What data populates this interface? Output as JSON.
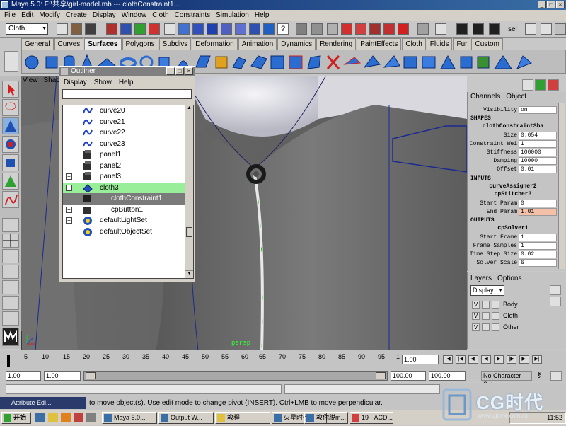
{
  "window": {
    "title": "Maya 5.0: F:\\共享\\girl-model.mb   ---   clothConstraint1..."
  },
  "menubar": [
    "File",
    "Edit",
    "Modify",
    "Create",
    "Display",
    "Window",
    "Cloth",
    "Constraints",
    "Simulation",
    "Help"
  ],
  "statusline": {
    "mode_menu": "Cloth",
    "sel_label": "sel"
  },
  "shelf": {
    "tabs": [
      "General",
      "Curves",
      "Surfaces",
      "Polygons",
      "Subdivs",
      "Deformation",
      "Animation",
      "Dynamics",
      "Rendering",
      "PaintEffects",
      "Cloth",
      "Fluids",
      "Fur",
      "Custom"
    ],
    "active_tab": "Surfaces"
  },
  "viewport": {
    "menu": [
      "View",
      "Shadi"
    ],
    "camera_label": "persp"
  },
  "outliner": {
    "title": "Outliner",
    "menu": [
      "Display",
      "Show",
      "Help"
    ],
    "items": [
      {
        "label": "curve20",
        "icon": "curve-icon",
        "expand": ""
      },
      {
        "label": "curve21",
        "icon": "curve-icon",
        "expand": ""
      },
      {
        "label": "curve22",
        "icon": "curve-icon",
        "expand": ""
      },
      {
        "label": "curve23",
        "icon": "curve-icon",
        "expand": ""
      },
      {
        "label": "panel1",
        "icon": "panel-icon",
        "expand": ""
      },
      {
        "label": "panel2",
        "icon": "panel-icon",
        "expand": ""
      },
      {
        "label": "panel3",
        "icon": "panel-icon",
        "expand": "+"
      },
      {
        "label": "cloth3",
        "icon": "cloth-icon",
        "expand": "−"
      },
      {
        "label": "clothConstraint1",
        "icon": "constraint-icon",
        "expand": ""
      },
      {
        "label": "cpButton1",
        "icon": "button-icon",
        "expand": "+"
      },
      {
        "label": "defaultLightSet",
        "icon": "set-icon",
        "expand": "+"
      },
      {
        "label": "defaultObjectSet",
        "icon": "set-icon",
        "expand": ""
      }
    ]
  },
  "channelbox": {
    "tabs": [
      "Channels",
      "Object"
    ],
    "visibility": {
      "label": "Visibility",
      "value": "on"
    },
    "shapes_header": "SHAPES",
    "shape_node": "clothConstraintSha",
    "shape_attrs": [
      {
        "label": "Size",
        "value": "0.054"
      },
      {
        "label": "Constraint Wei",
        "value": "1"
      },
      {
        "label": "Stiffness",
        "value": "100000"
      },
      {
        "label": "Damping",
        "value": "10000"
      },
      {
        "label": "Offset",
        "value": "0.01"
      }
    ],
    "inputs_header": "INPUTS",
    "input_node_1": "curveAssigner2",
    "input_node_2": "cpStitcher3",
    "input_attrs": [
      {
        "label": "Start Param",
        "value": "0"
      },
      {
        "label": "End Param",
        "value": "1.01"
      }
    ],
    "outputs_header": "OUTPUTS",
    "output_node": "cpSolver1",
    "output_attrs": [
      {
        "label": "Start Frame",
        "value": "1"
      },
      {
        "label": "Frame Samples",
        "value": "1"
      },
      {
        "label": "Time Step Size",
        "value": "0.02"
      },
      {
        "label": "Solver Scale",
        "value": "6"
      }
    ]
  },
  "layers": {
    "tabs": [
      "Layers",
      "Options"
    ],
    "display_menu": "Display",
    "items": [
      {
        "visible": "V",
        "name": "Body"
      },
      {
        "visible": "V",
        "name": "Cloth"
      },
      {
        "visible": "V",
        "name": "Other"
      }
    ]
  },
  "timeline": {
    "ticks": [
      "5",
      "10",
      "15",
      "20",
      "25",
      "30",
      "35",
      "40",
      "45",
      "50",
      "55",
      "60",
      "65",
      "70",
      "75",
      "80",
      "85",
      "90",
      "95",
      "1"
    ],
    "current_frame": "1.00"
  },
  "range": {
    "start": "1.00",
    "start_inner": "1.00",
    "end_inner": "100.00",
    "end": "100.00",
    "character": "No Character Set"
  },
  "helpline": {
    "attr_editor_label": "Attribute Edi...",
    "text": "to move object(s). Use edit mode to change pivot (INSERT). Ctrl+LMB to move perpendicular."
  },
  "taskbar": {
    "start_label": "开始",
    "buttons": [
      "Maya 5.0...",
      "Output W...",
      "教程",
      "火星时代...",
      "教你脱m...",
      "19 - ACD..."
    ],
    "clock": "11:52"
  },
  "logo": {
    "text": "CG时代",
    "url": "www.cgtime.com.cn"
  },
  "colors": {
    "accent": "#0a246a",
    "selection_green": "#99ee99",
    "highlight_value": "#f4c0a8"
  }
}
